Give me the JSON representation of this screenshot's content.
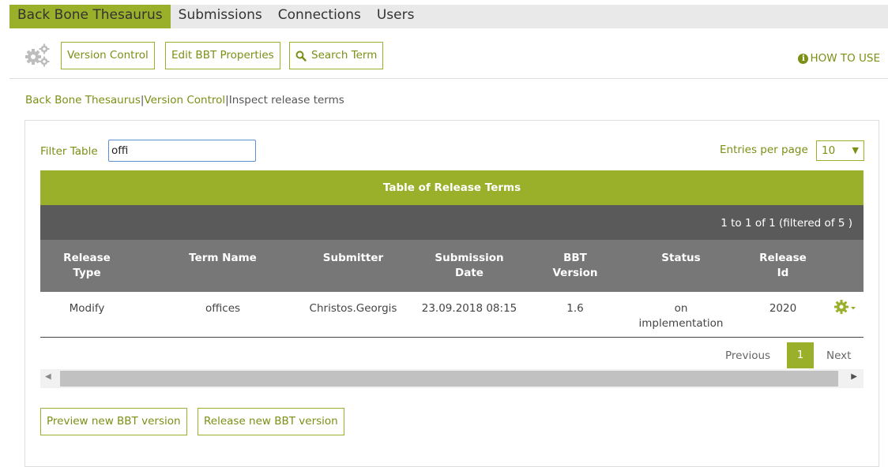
{
  "topnav": {
    "items": [
      {
        "label": "Back Bone Thesaurus",
        "active": true
      },
      {
        "label": "Submissions"
      },
      {
        "label": "Connections"
      },
      {
        "label": "Users"
      }
    ]
  },
  "toolbar": {
    "version_control": "Version Control",
    "edit_props": "Edit BBT Properties",
    "search_term": "Search Term",
    "how_to_use": "HOW TO USE"
  },
  "breadcrumb": {
    "items": [
      "Back Bone Thesaurus",
      "Version Control",
      "Inspect release terms"
    ],
    "separator": "|"
  },
  "filter": {
    "label": "Filter Table",
    "value": "offi"
  },
  "entries": {
    "label": "Entries per page",
    "value": "10"
  },
  "table": {
    "title": "Table of Release Terms",
    "info": "1 to 1 of 1 (filtered of 5 )",
    "headers": [
      [
        "Release",
        "Type"
      ],
      [
        "Term Name",
        ""
      ],
      [
        "Submitter",
        ""
      ],
      [
        "Submission",
        "Date"
      ],
      [
        "BBT",
        "Version"
      ],
      [
        "Status",
        ""
      ],
      [
        "Release",
        "Id"
      ]
    ],
    "rows": [
      {
        "release_type": "Modify",
        "term_name": "offices",
        "submitter": "Christos.Georgis",
        "submission_date": "23.09.2018 08:15",
        "bbt_version": "1.6",
        "status_line1": "on",
        "status_line2": "implementation",
        "release_id": "2020"
      }
    ]
  },
  "pager": {
    "previous": "Previous",
    "page": "1",
    "next": "Next"
  },
  "actions": {
    "preview": "Preview new BBT version",
    "release": "Release new BBT version"
  },
  "colors": {
    "accent": "#9bb02a",
    "accent_text": "#7b8f15",
    "info_bar": "#5a5a5a",
    "header_bar": "#777777"
  }
}
